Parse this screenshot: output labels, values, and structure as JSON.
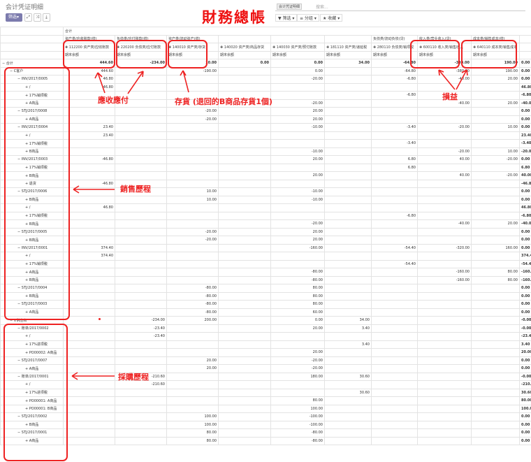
{
  "page": {
    "title": "会计凭证明细"
  },
  "annotation_title": "財務總帳",
  "toolbar": {
    "pivot_label": "筛选▾",
    "expand_icon": "expand-icon",
    "flip_icon": "flip-axis-icon",
    "download_icon": "download-icon"
  },
  "search": {
    "facet": "会计凭证明细",
    "placeholder": "搜索..."
  },
  "filters": {
    "filter_label": "▼ 筛选 ▾",
    "group_label": "≡ 分组 ▾",
    "fav_label": "★ 收藏 ▾"
  },
  "header": {
    "total": "合计",
    "groups": [
      "资产类/应收账款(借)",
      "负债类/应付账款(借)",
      "资产类/流动资产(借)",
      "",
      "",
      "",
      "负债类/流动负债(贷)",
      "收入类/营业收入(贷)",
      "成本类/销售成本(借)"
    ],
    "accounts": [
      "112200 资产类/应收账款",
      "220200 负债类/应付账款",
      "140010 资产类/存货",
      "140020 资产类/商品存货",
      "140030 资产类/预付账款",
      "181110 资产类/递延税",
      "280110 负债类/销项税",
      "600110 收入类/销售收入",
      "640110 成本类/销售成本"
    ],
    "measure": "期末余额"
  },
  "rows": [
    {
      "l": "合计",
      "i": 0,
      "s": "−",
      "t": 1,
      "c": [
        "444.60",
        "-234.00",
        "10.00",
        "0.00",
        "0.00",
        "34.00",
        "-64.80",
        "-380.00",
        "190.00",
        "0.00"
      ]
    },
    {
      "l": "C客户",
      "i": 1,
      "s": "−",
      "c": [
        "444.60",
        "",
        "-190.00",
        "",
        "0.00",
        "",
        "-64.80",
        "-380.00",
        "190.00",
        "0.00"
      ]
    },
    {
      "l": "INV/2017/0005",
      "i": 2,
      "s": "−",
      "c": [
        "46.80",
        "",
        "",
        "",
        "-20.00",
        "",
        "-6.80",
        "-40.00",
        "20.00",
        "0.00"
      ]
    },
    {
      "l": "/",
      "i": 3,
      "s": "+",
      "c": [
        "46.80",
        "",
        "",
        "",
        "",
        "",
        "",
        "",
        "",
        "46.80"
      ]
    },
    {
      "l": "17%销项税",
      "i": 3,
      "s": "+",
      "c": [
        "",
        "",
        "",
        "",
        "",
        "",
        "-6.80",
        "",
        "",
        "-6.80"
      ]
    },
    {
      "l": "A商品",
      "i": 3,
      "s": "+",
      "c": [
        "",
        "",
        "",
        "",
        "-20.00",
        "",
        "",
        "-40.00",
        "20.00",
        "-40.00"
      ]
    },
    {
      "l": "STJ/2017/0008",
      "i": 2,
      "s": "−",
      "c": [
        "",
        "",
        "-20.00",
        "",
        "20.00",
        "",
        "",
        "",
        "",
        "0.00"
      ]
    },
    {
      "l": "A商品",
      "i": 3,
      "s": "+",
      "c": [
        "",
        "",
        "-20.00",
        "",
        "20.00",
        "",
        "",
        "",
        "",
        "0.00"
      ]
    },
    {
      "l": "INV/2017/0004",
      "i": 2,
      "s": "−",
      "c": [
        "23.40",
        "",
        "",
        "",
        "-10.00",
        "",
        "-3.40",
        "-20.00",
        "10.00",
        "0.00"
      ]
    },
    {
      "l": "/",
      "i": 3,
      "s": "+",
      "c": [
        "23.40",
        "",
        "",
        "",
        "",
        "",
        "",
        "",
        "",
        "23.40"
      ]
    },
    {
      "l": "17%销项税",
      "i": 3,
      "s": "+",
      "c": [
        "",
        "",
        "",
        "",
        "",
        "",
        "-3.40",
        "",
        "",
        "-3.40"
      ]
    },
    {
      "l": "B商品",
      "i": 3,
      "s": "+",
      "c": [
        "",
        "",
        "",
        "",
        "-10.00",
        "",
        "",
        "-20.00",
        "10.00",
        "-20.00"
      ]
    },
    {
      "l": "INV/2017/0003",
      "i": 2,
      "s": "−",
      "c": [
        "-46.80",
        "",
        "",
        "",
        "20.00",
        "",
        "6.80",
        "40.00",
        "-20.00",
        "0.00"
      ]
    },
    {
      "l": "17%销项税",
      "i": 3,
      "s": "+",
      "c": [
        "",
        "",
        "",
        "",
        "",
        "",
        "6.80",
        "",
        "",
        "6.80"
      ]
    },
    {
      "l": "B商品",
      "i": 3,
      "s": "+",
      "c": [
        "",
        "",
        "",
        "",
        "20.00",
        "",
        "",
        "40.00",
        "-20.00",
        "40.00"
      ]
    },
    {
      "l": "退货",
      "i": 3,
      "s": "+",
      "c": [
        "-46.80",
        "",
        "",
        "",
        "",
        "",
        "",
        "",
        "",
        "-46.80"
      ]
    },
    {
      "l": "STJ/2017/0006",
      "i": 2,
      "s": "−",
      "c": [
        "",
        "",
        "10.00",
        "",
        "-10.00",
        "",
        "",
        "",
        "",
        "0.00"
      ]
    },
    {
      "l": "B商品",
      "i": 3,
      "s": "+",
      "c": [
        "",
        "",
        "10.00",
        "",
        "-10.00",
        "",
        "",
        "",
        "",
        "0.00"
      ]
    },
    {
      "l": "/",
      "i": 3,
      "s": "+",
      "c": [
        "46.80",
        "",
        "",
        "",
        "",
        "",
        "",
        "",
        "",
        "46.80"
      ]
    },
    {
      "l": "17%销项税",
      "i": 3,
      "s": "+",
      "c": [
        "",
        "",
        "",
        "",
        "",
        "",
        "-6.80",
        "",
        "",
        "-6.80"
      ]
    },
    {
      "l": "B商品",
      "i": 3,
      "s": "+",
      "c": [
        "",
        "",
        "",
        "",
        "-20.00",
        "",
        "",
        "-40.00",
        "20.00",
        "-40.00"
      ]
    },
    {
      "l": "STJ/2017/0005",
      "i": 2,
      "s": "−",
      "c": [
        "",
        "",
        "-20.00",
        "",
        "20.00",
        "",
        "",
        "",
        "",
        "0.00"
      ]
    },
    {
      "l": "B商品",
      "i": 3,
      "s": "+",
      "c": [
        "",
        "",
        "-20.00",
        "",
        "20.00",
        "",
        "",
        "",
        "",
        "0.00"
      ]
    },
    {
      "l": "INV/2017/0001",
      "i": 2,
      "s": "−",
      "c": [
        "374.40",
        "",
        "",
        "",
        "-160.00",
        "",
        "-54.40",
        "-320.00",
        "160.00",
        "0.00"
      ]
    },
    {
      "l": "/",
      "i": 3,
      "s": "+",
      "c": [
        "374.40",
        "",
        "",
        "",
        "",
        "",
        "",
        "",
        "",
        "374.40"
      ]
    },
    {
      "l": "17%销项税",
      "i": 3,
      "s": "+",
      "c": [
        "",
        "",
        "",
        "",
        "",
        "",
        "-54.40",
        "",
        "",
        "-54.40"
      ]
    },
    {
      "l": "A商品",
      "i": 3,
      "s": "+",
      "c": [
        "",
        "",
        "",
        "",
        "-80.00",
        "",
        "",
        "-160.00",
        "80.00",
        "-160.00"
      ]
    },
    {
      "l": "B商品",
      "i": 3,
      "s": "+",
      "c": [
        "",
        "",
        "",
        "",
        "-80.00",
        "",
        "",
        "-160.00",
        "80.00",
        "-160.00"
      ]
    },
    {
      "l": "STJ/2017/0004",
      "i": 2,
      "s": "−",
      "c": [
        "",
        "",
        "-80.00",
        "",
        "80.00",
        "",
        "",
        "",
        "",
        "0.00"
      ]
    },
    {
      "l": "B商品",
      "i": 3,
      "s": "+",
      "c": [
        "",
        "",
        "-80.00",
        "",
        "80.00",
        "",
        "",
        "",
        "",
        "0.00"
      ]
    },
    {
      "l": "STJ/2017/0003",
      "i": 2,
      "s": "−",
      "c": [
        "",
        "",
        "-80.00",
        "",
        "80.00",
        "",
        "",
        "",
        "",
        "0.00"
      ]
    },
    {
      "l": "A商品",
      "i": 3,
      "s": "+",
      "c": [
        "",
        "",
        "-80.00",
        "",
        "60.00",
        "",
        "",
        "",
        "",
        "0.00"
      ]
    },
    {
      "l": "V供应商",
      "i": 1,
      "s": "−",
      "c": [
        "",
        "-234.00",
        "200.00",
        "",
        "0.00",
        "34.00",
        "",
        "",
        "",
        "-0.00"
      ]
    },
    {
      "l": "账单/2017/0002",
      "i": 2,
      "s": "−",
      "c": [
        "",
        "-23.40",
        "",
        "",
        "20.00",
        "3.40",
        "",
        "",
        "",
        "-0.00"
      ]
    },
    {
      "l": "/",
      "i": 3,
      "s": "+",
      "c": [
        "",
        "-23.40",
        "",
        "",
        "",
        "",
        "",
        "",
        "",
        "-23.40"
      ]
    },
    {
      "l": "17%进项税",
      "i": 3,
      "s": "+",
      "c": [
        "",
        "",
        "",
        "",
        "",
        "3.40",
        "",
        "",
        "",
        "3.40"
      ]
    },
    {
      "l": "PO00002: A商品",
      "i": 3,
      "s": "+",
      "c": [
        "",
        "",
        "",
        "",
        "20.00",
        "",
        "",
        "",
        "",
        "20.00"
      ]
    },
    {
      "l": "STJ/2017/0007",
      "i": 2,
      "s": "−",
      "c": [
        "",
        "",
        "20.00",
        "",
        "-20.00",
        "",
        "",
        "",
        "",
        "0.00"
      ]
    },
    {
      "l": "A商品",
      "i": 3,
      "s": "+",
      "c": [
        "",
        "",
        "20.00",
        "",
        "-20.00",
        "",
        "",
        "",
        "",
        "0.00"
      ]
    },
    {
      "l": "账单/2017/0001",
      "i": 2,
      "s": "−",
      "c": [
        "",
        "-210.60",
        "",
        "",
        "180.00",
        "30.60",
        "",
        "",
        "",
        "-0.00"
      ]
    },
    {
      "l": "/",
      "i": 3,
      "s": "+",
      "c": [
        "",
        "-210.60",
        "",
        "",
        "",
        "",
        "",
        "",
        "",
        "-210.60"
      ]
    },
    {
      "l": "17%进项税",
      "i": 3,
      "s": "+",
      "c": [
        "",
        "",
        "",
        "",
        "",
        "30.60",
        "",
        "",
        "",
        "30.60"
      ]
    },
    {
      "l": "PO00001: A商品",
      "i": 3,
      "s": "+",
      "c": [
        "",
        "",
        "",
        "",
        "80.00",
        "",
        "",
        "",
        "",
        "80.00"
      ]
    },
    {
      "l": "PO00001: B商品",
      "i": 3,
      "s": "+",
      "c": [
        "",
        "",
        "",
        "",
        "100.00",
        "",
        "",
        "",
        "",
        "100.00"
      ]
    },
    {
      "l": "STJ/2017/0002",
      "i": 2,
      "s": "−",
      "c": [
        "",
        "",
        "100.00",
        "",
        "-100.00",
        "",
        "",
        "",
        "",
        "0.00"
      ]
    },
    {
      "l": "B商品",
      "i": 3,
      "s": "+",
      "c": [
        "",
        "",
        "100.00",
        "",
        "-100.00",
        "",
        "",
        "",
        "",
        "0.00"
      ]
    },
    {
      "l": "STJ/2017/0001",
      "i": 2,
      "s": "−",
      "c": [
        "",
        "",
        "80.00",
        "",
        "-80.00",
        "",
        "",
        "",
        "",
        "0.00"
      ]
    },
    {
      "l": "A商品",
      "i": 3,
      "s": "+",
      "c": [
        "",
        "",
        "80.00",
        "",
        "-80.00",
        "",
        "",
        "",
        "",
        "0.00"
      ]
    }
  ],
  "annotations": {
    "ar_ap": "應收應付",
    "inventory": "存貨 (退回的B商品存貨1個)",
    "pl": "損益",
    "sales": "銷售歷程",
    "purchase": "採購歷程"
  },
  "colors": {
    "annotation": "#e22",
    "pivot_button": "#7c7bad"
  }
}
